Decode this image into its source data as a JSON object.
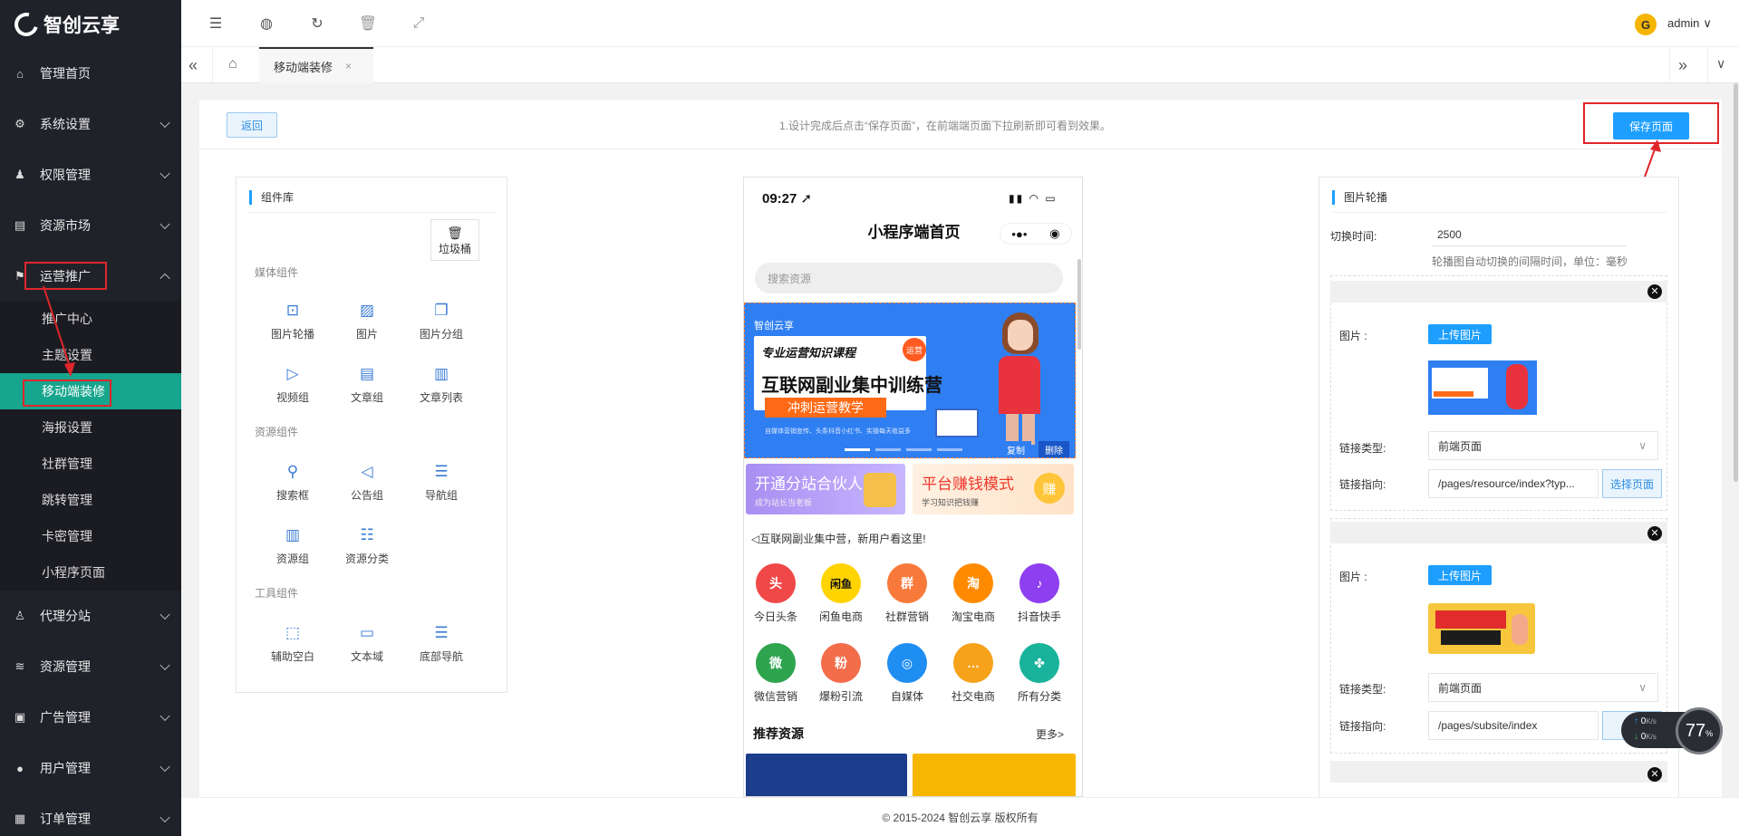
{
  "brand": {
    "name": "智创云享"
  },
  "sidebar": {
    "items": [
      {
        "label": "管理首页",
        "icon": "home-icon"
      },
      {
        "label": "系统设置",
        "icon": "gear-icon"
      },
      {
        "label": "权限管理",
        "icon": "user-key-icon"
      },
      {
        "label": "资源市场",
        "icon": "store-icon"
      },
      {
        "label": "运营推广",
        "icon": "flag-icon"
      },
      {
        "label": "代理分站",
        "icon": "users-icon"
      },
      {
        "label": "资源管理",
        "icon": "layers-icon"
      },
      {
        "label": "广告管理",
        "icon": "ad-icon"
      },
      {
        "label": "用户管理",
        "icon": "user-icon"
      },
      {
        "label": "订单管理",
        "icon": "order-icon"
      }
    ],
    "sub_items": [
      "推广中心",
      "主题设置",
      "移动端装修",
      "海报设置",
      "社群管理",
      "跳转管理",
      "卡密管理",
      "小程序页面"
    ]
  },
  "topbar": {
    "user": "admin"
  },
  "tabs": {
    "active": "移动端装修"
  },
  "toolbar": {
    "back_label": "返回",
    "hint": "1.设计完成后点击“保存页面”，在前端端页面下拉刷新即可看到效果。",
    "save_label": "保存页面"
  },
  "components_panel": {
    "title": "组件库",
    "trash_label": "垃圾桶",
    "groups": [
      {
        "label": "媒体组件",
        "items": [
          {
            "label": "图片轮播",
            "icon": "carousel-icon"
          },
          {
            "label": "图片",
            "icon": "image-icon"
          },
          {
            "label": "图片分组",
            "icon": "image-group-icon"
          },
          {
            "label": "视频组",
            "icon": "video-icon"
          },
          {
            "label": "文章组",
            "icon": "article-icon"
          },
          {
            "label": "文章列表",
            "icon": "article-list-icon"
          }
        ]
      },
      {
        "label": "资源组件",
        "items": [
          {
            "label": "搜索框",
            "icon": "search-icon"
          },
          {
            "label": "公告组",
            "icon": "announcement-icon"
          },
          {
            "label": "导航组",
            "icon": "nav-list-icon"
          },
          {
            "label": "资源组",
            "icon": "books-icon"
          },
          {
            "label": "资源分类",
            "icon": "category-icon"
          }
        ]
      },
      {
        "label": "工具组件",
        "items": [
          {
            "label": "辅助空白",
            "icon": "blank-icon"
          },
          {
            "label": "文本域",
            "icon": "textarea-icon"
          },
          {
            "label": "底部导航",
            "icon": "bottom-nav-icon"
          }
        ]
      }
    ]
  },
  "phone": {
    "time": "09:27",
    "title": "小程序端首页",
    "search_placeholder": "搜索资源",
    "banner": {
      "brand": "智创云享",
      "line1": "专业运营知识课程",
      "badge": "运营",
      "line2": "互联网副业集中训练营",
      "line3": "冲刺运营教学",
      "line4": "自媒体营销宣传、头条抖音小红书、实操每天收益多",
      "copy_label": "复制",
      "delete_label": "删除"
    },
    "promo_left": {
      "title": "开通分站合伙人",
      "sub": "成为站长当老板"
    },
    "promo_right": {
      "title": "平台赚钱模式",
      "sub": "学习知识把钱赚",
      "badge": "赚"
    },
    "notice": "互联网副业集中营，新用户看这里!",
    "apps": [
      {
        "label": "今日头条",
        "glyph": "头",
        "color": "#f04848"
      },
      {
        "label": "闲鱼电商",
        "glyph": "闲鱼",
        "color": "#ffd400"
      },
      {
        "label": "社群营销",
        "glyph": "群",
        "color": "#f87a3a"
      },
      {
        "label": "淘宝电商",
        "glyph": "淘",
        "color": "#ff8a00"
      },
      {
        "label": "抖音快手",
        "glyph": "♪",
        "color": "#8e3ff0"
      },
      {
        "label": "微信营销",
        "glyph": "微",
        "color": "#2ea44f"
      },
      {
        "label": "爆粉引流",
        "glyph": "粉",
        "color": "#f36d4a"
      },
      {
        "label": "自媒体",
        "glyph": "◎",
        "color": "#1f8ef2"
      },
      {
        "label": "社交电商",
        "glyph": "…",
        "color": "#f7a21b"
      },
      {
        "label": "所有分类",
        "glyph": "✤",
        "color": "#19b39b"
      }
    ],
    "rec_title": "推荐资源",
    "rec_more": "更多>"
  },
  "settings": {
    "title": "图片轮播",
    "interval_label": "切换时间:",
    "interval_value": "2500",
    "interval_hint": "轮播图自动切换的间隔时间，单位：毫秒",
    "slides": [
      {
        "image_label": "图片 :",
        "upload_label": "上传图片",
        "link_type_label": "链接类型:",
        "link_type_value": "前端页面",
        "link_target_label": "链接指向:",
        "link_target_value": "/pages/resource/index?typ...",
        "choose_label": "选择页面"
      },
      {
        "image_label": "图片 :",
        "upload_label": "上传图片",
        "link_type_label": "链接类型:",
        "link_type_value": "前端页面",
        "link_target_label": "链接指向:",
        "link_target_value": "/pages/subsite/index",
        "choose_label": "选"
      }
    ]
  },
  "netmonitor": {
    "up": "0",
    "down": "0",
    "unit": "K/s",
    "percent": "77",
    "pct_unit": "%"
  },
  "footer": {
    "copyright": "© 2015-2024 智创云享 版权所有"
  }
}
